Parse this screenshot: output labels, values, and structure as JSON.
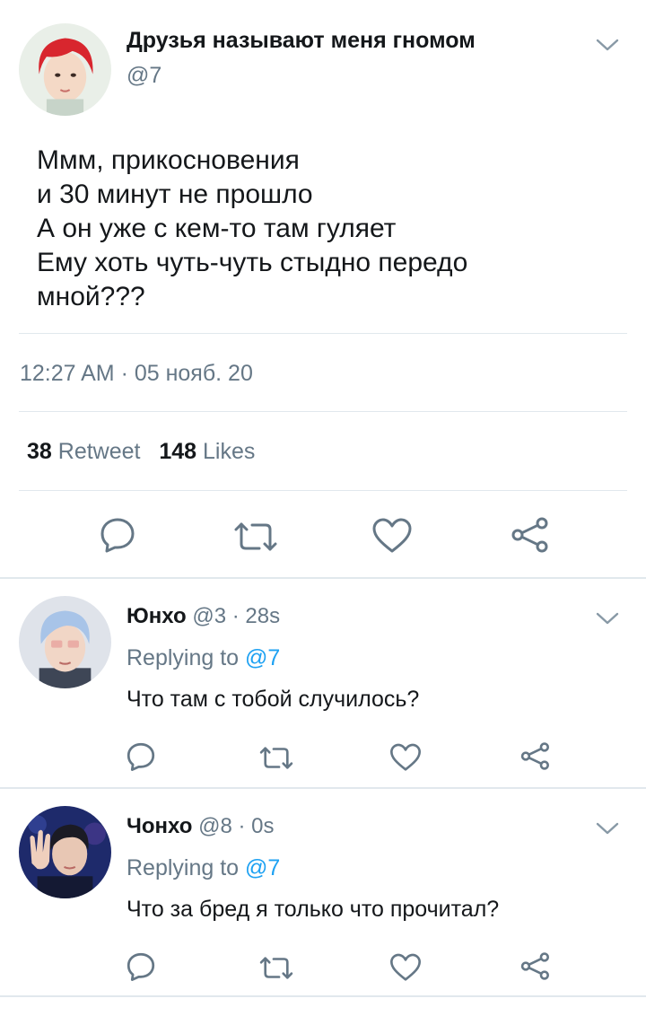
{
  "main_tweet": {
    "display_name": "Друзья называют меня гномом",
    "handle": "@7",
    "text_lines": [
      "Ммм, прикосновения",
      "и 30 минут не прошло",
      "А он уже с кем-то там гуляет",
      "Ему хоть чуть-чуть стыдно передо",
      "мной???"
    ],
    "timestamp": "12:27 AM · 05 нояб. 20",
    "retweets": "38",
    "retweets_label": "Retweet",
    "likes": "148",
    "likes_label": "Likes",
    "avatar_icon": "avatar-red-hair"
  },
  "replies": [
    {
      "display_name": "Юнхо",
      "handle_time": "@3 · 28s",
      "replying_prefix": "Replying to",
      "replying_mention": "@7",
      "text": "Что там с тобой случилось?",
      "avatar_icon": "avatar-blue-hair"
    },
    {
      "display_name": "Чонхо",
      "handle_time": "@8 · 0s",
      "replying_prefix": "Replying to",
      "replying_mention": "@7",
      "text": "Что за бред я только что прочитал?",
      "avatar_icon": "avatar-waving"
    }
  ],
  "icons": [
    "reply-icon",
    "retweet-icon",
    "like-icon",
    "share-icon",
    "chevron-down-icon"
  ],
  "colors": {
    "text": "#14171a",
    "secondary": "#657786",
    "mention": "#1da1f2",
    "divider": "#e1e8ed",
    "icon": "#657786"
  }
}
